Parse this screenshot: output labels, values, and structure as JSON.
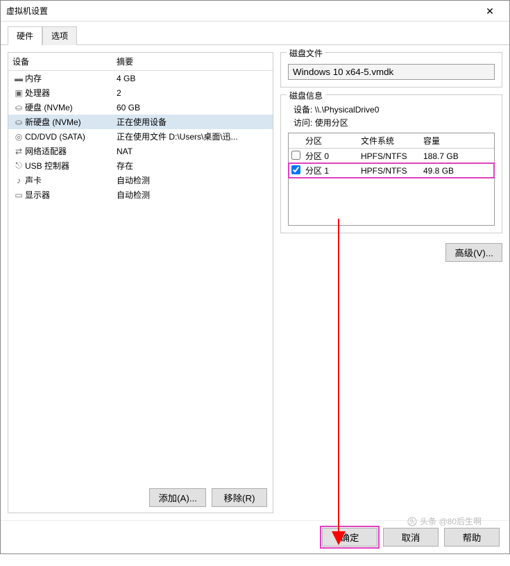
{
  "window": {
    "title": "虚拟机设置",
    "close": "✕"
  },
  "tabs": {
    "hardware": "硬件",
    "options": "选项"
  },
  "device_table": {
    "col_device": "设备",
    "col_summary": "摘要"
  },
  "devices": [
    {
      "icon": "memory-icon",
      "name": "内存",
      "summary": "4 GB"
    },
    {
      "icon": "cpu-icon",
      "name": "处理器",
      "summary": "2"
    },
    {
      "icon": "disk-icon",
      "name": "硬盘 (NVMe)",
      "summary": "60 GB"
    },
    {
      "icon": "disk-icon",
      "name": "新硬盘 (NVMe)",
      "summary": "正在使用设备",
      "selected": true
    },
    {
      "icon": "cd-icon",
      "name": "CD/DVD (SATA)",
      "summary": "正在使用文件 D:\\Users\\桌面\\迅..."
    },
    {
      "icon": "network-icon",
      "name": "网络适配器",
      "summary": "NAT"
    },
    {
      "icon": "usb-icon",
      "name": "USB 控制器",
      "summary": "存在"
    },
    {
      "icon": "sound-icon",
      "name": "声卡",
      "summary": "自动检测"
    },
    {
      "icon": "display-icon",
      "name": "显示器",
      "summary": "自动检测"
    }
  ],
  "left_buttons": {
    "add": "添加(A)...",
    "remove": "移除(R)"
  },
  "disk_file_group": {
    "legend": "磁盘文件",
    "value": "Windows 10 x64-5.vmdk"
  },
  "disk_info_group": {
    "legend": "磁盘信息",
    "device_label": "设备:",
    "device_value": "\\\\.\\PhysicalDrive0",
    "access_label": "访问:",
    "access_value": "使用分区"
  },
  "partition_table": {
    "col_partition": "分区",
    "col_filesystem": "文件系统",
    "col_capacity": "容量",
    "rows": [
      {
        "checked": false,
        "name": "分区 0",
        "fs": "HPFS/NTFS",
        "cap": "188.7 GB"
      },
      {
        "checked": true,
        "name": "分区 1",
        "fs": "HPFS/NTFS",
        "cap": "49.8 GB",
        "highlight": true
      }
    ]
  },
  "advanced_btn": "高级(V)...",
  "footer": {
    "ok": "确定",
    "cancel": "取消",
    "help": "帮助"
  },
  "watermark": "头条 @80后生啊"
}
